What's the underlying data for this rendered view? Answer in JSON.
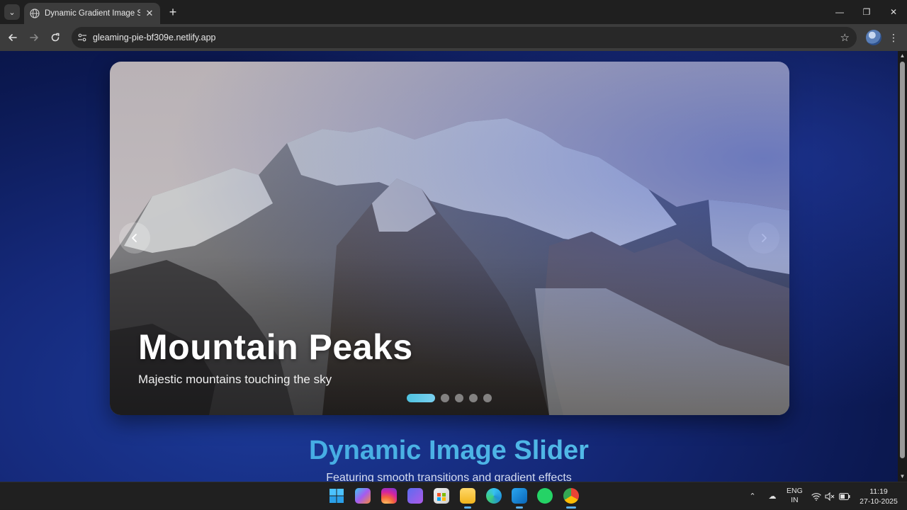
{
  "browser": {
    "tab_title": "Dynamic Gradient Image Slider",
    "tab_close": "✕",
    "new_tab": "+",
    "url": "gleaming-pie-bf309e.netlify.app",
    "icons": {
      "tab_search": "chevron-down-icon",
      "back": "arrow-left-icon",
      "forward": "arrow-right-icon",
      "reload": "reload-icon",
      "bookmark": "star-icon",
      "menu": "more-vertical-icon"
    },
    "window": {
      "minimize": "—",
      "maximize": "❐",
      "close": "✕"
    }
  },
  "slider": {
    "slide": {
      "title": "Mountain Peaks",
      "description": "Majestic mountains touching the sky"
    },
    "prev_label": "‹",
    "next_label": "›",
    "dot_count": 5,
    "active_dot": 0,
    "accent_color": "#4fc3e0"
  },
  "page": {
    "heading": "Dynamic Image Slider",
    "subheading": "Featuring smooth transitions and gradient effects"
  },
  "taskbar": {
    "apps": [
      "start",
      "copilot",
      "instagram",
      "clipchamp",
      "microsoft-store",
      "file-explorer",
      "edge",
      "vscode",
      "whatsapp",
      "chrome"
    ],
    "tray": {
      "lang_line1": "ENG",
      "lang_line2": "IN",
      "time": "11:19",
      "date": "27-10-2025"
    }
  }
}
